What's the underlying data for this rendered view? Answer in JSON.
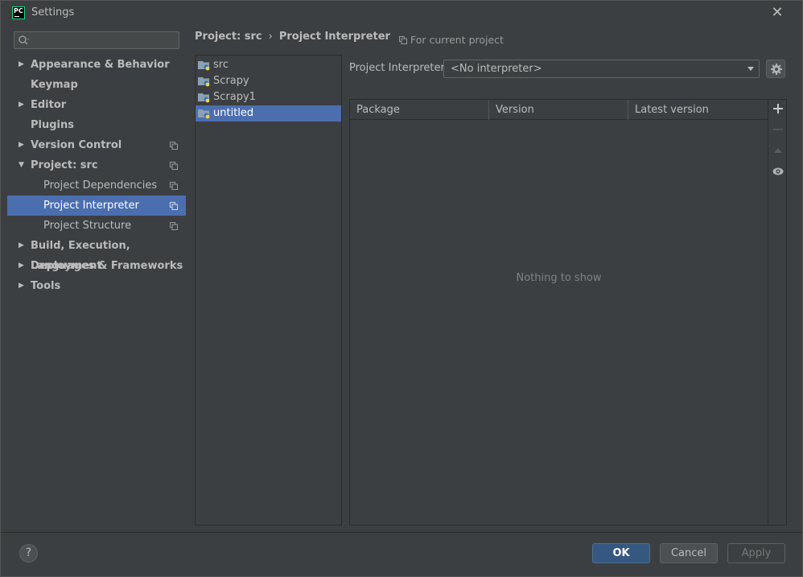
{
  "window": {
    "title": "Settings",
    "app_icon_text": "PC"
  },
  "sidebar": {
    "search_placeholder": "",
    "items": [
      {
        "label": "Appearance & Behavior",
        "bold": true,
        "arrow": "right"
      },
      {
        "label": "Keymap",
        "bold": true,
        "arrow": ""
      },
      {
        "label": "Editor",
        "bold": true,
        "arrow": "right"
      },
      {
        "label": "Plugins",
        "bold": true,
        "arrow": ""
      },
      {
        "label": "Version Control",
        "bold": true,
        "arrow": "right"
      },
      {
        "label": "Project: src",
        "bold": true,
        "arrow": "down"
      },
      {
        "label": "Project Dependencies",
        "bold": false,
        "arrow": ""
      },
      {
        "label": "Project Interpreter",
        "bold": false,
        "arrow": "",
        "selected": true
      },
      {
        "label": "Project Structure",
        "bold": false,
        "arrow": ""
      },
      {
        "label": "Build, Execution, Deployment",
        "bold": true,
        "arrow": "right"
      },
      {
        "label": "Languages & Frameworks",
        "bold": true,
        "arrow": "right"
      },
      {
        "label": "Tools",
        "bold": true,
        "arrow": "right"
      }
    ]
  },
  "breadcrumb": {
    "parent": "Project: src",
    "separator": "›",
    "current": "Project Interpreter"
  },
  "scope_note": "For current project",
  "projects": [
    {
      "name": "src"
    },
    {
      "name": "Scrapy"
    },
    {
      "name": "Scrapy1"
    },
    {
      "name": "untitled",
      "selected": true
    }
  ],
  "interpreter": {
    "label": "Project Interpreter:",
    "value": "<No interpreter>"
  },
  "packages": {
    "columns": [
      "Package",
      "Version",
      "Latest version"
    ],
    "rows": [],
    "empty_text": "Nothing to show"
  },
  "buttons": {
    "help": "?",
    "ok": "OK",
    "cancel": "Cancel",
    "apply": "Apply"
  },
  "colors": {
    "background": "#3c3f41",
    "selection": "#4b6eaf",
    "ok_button": "#365880"
  }
}
